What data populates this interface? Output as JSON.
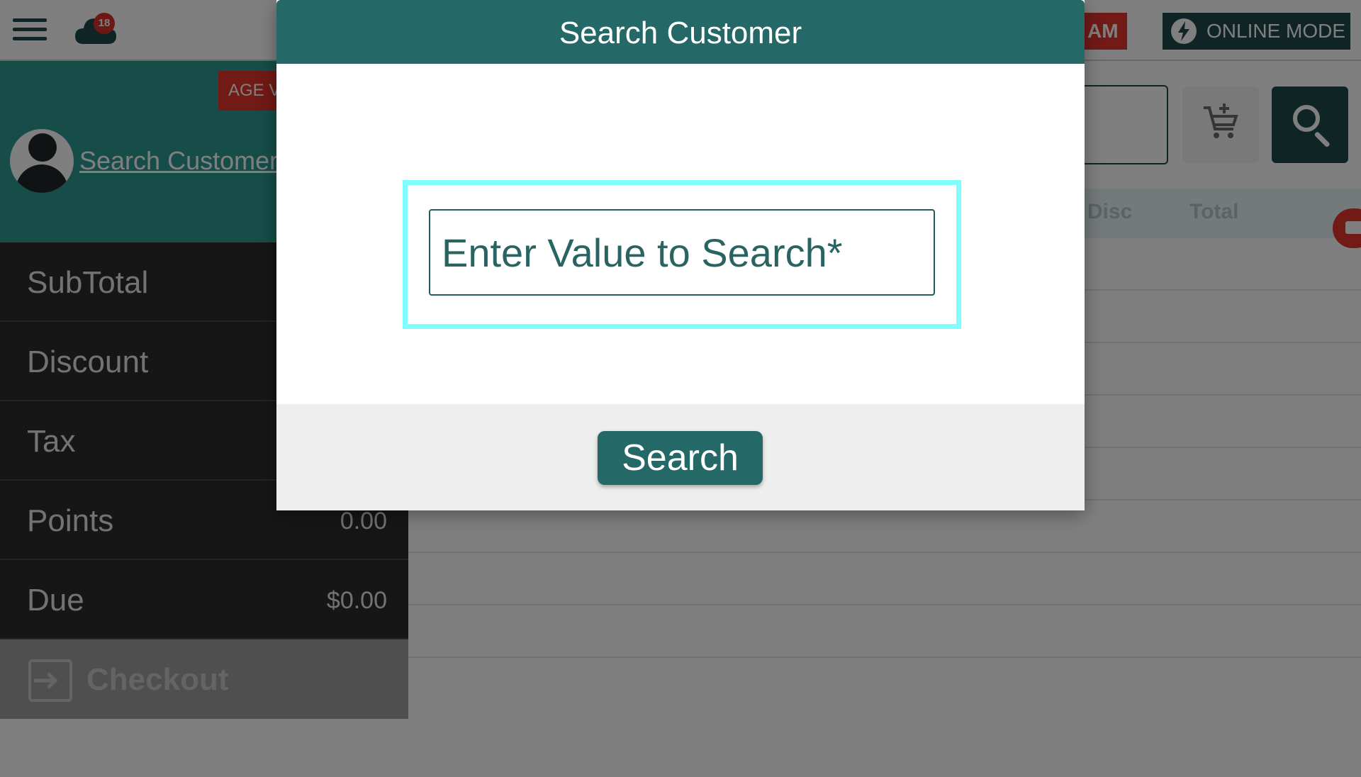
{
  "topbar": {
    "notification_count": "18",
    "am_label": "AM",
    "online_mode_label": "ONLINE MODE"
  },
  "customer": {
    "age_badge": "AGE V",
    "search_link": "Search Customer"
  },
  "summary": {
    "rows": [
      {
        "label": "SubTotal",
        "value": ""
      },
      {
        "label": "Discount",
        "value": ""
      },
      {
        "label": "Tax",
        "value": ""
      },
      {
        "label": "Points",
        "value": "0.00"
      },
      {
        "label": "Due",
        "value": "$0.00"
      }
    ],
    "checkout_label": "Checkout"
  },
  "table": {
    "headers": [
      "Disc",
      "Total"
    ]
  },
  "modal": {
    "title": "Search Customer",
    "input_placeholder": "Enter Value to Search*",
    "input_value": "",
    "search_button": "Search"
  },
  "colors": {
    "header_teal": "#246867",
    "focus_ring": "#80fdfd",
    "alert_red": "#e2352c",
    "dark_teal": "#1f4a4a"
  },
  "icons": [
    "menu-icon",
    "cloud-icon",
    "lightning-icon",
    "user-avatar-icon",
    "cart-add-icon",
    "search-icon",
    "checkout-icon",
    "card-icon"
  ]
}
